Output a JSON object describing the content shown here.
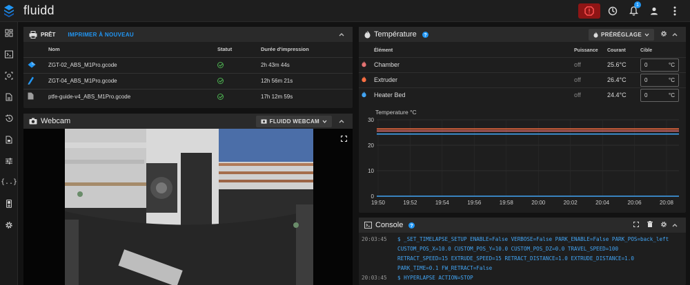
{
  "app": {
    "title": "fluidd",
    "notification_count": "1"
  },
  "colors": {
    "accent": "#2196f3",
    "estop": "#8e1515",
    "ok": "#4caf50",
    "chamber": "#e57373",
    "extruder": "#ff7043",
    "bed": "#42a5f5"
  },
  "sidebar": {
    "items": [
      "dashboard-icon",
      "console-icon",
      "camera-icon",
      "file-icon",
      "history-icon",
      "macro-file-icon",
      "tune-icon",
      "code-braces-icon",
      "device-icon",
      "settings-icon"
    ]
  },
  "status_panel": {
    "title": "PRÊT",
    "reprint_label": "IMPRIMER À NOUVEAU",
    "columns": [
      "Nom",
      "Statut",
      "Durée d'impression"
    ],
    "rows": [
      {
        "name": "ZGT-02_ABS_M1Pro.gcode",
        "time": "2h 43m 44s",
        "icon": "cube-icon"
      },
      {
        "name": "ZGT-04_ABS_M1Pro.gcode",
        "time": "12h 56m 21s",
        "icon": "blade-icon"
      },
      {
        "name": "ptfe-guide-v4_ABS_M1Pro.gcode",
        "time": "17h 12m 59s",
        "icon": "file-icon"
      }
    ]
  },
  "webcam_panel": {
    "title": "Webcam",
    "camera_button": "FLUIDD WEBCAM"
  },
  "temperature_panel": {
    "title": "Température",
    "preset_button": "PRÉRÉGLAGE",
    "columns": [
      "Élément",
      "Puissance",
      "Courant",
      "Cible"
    ],
    "rows": [
      {
        "name": "Chamber",
        "power": "off",
        "current": "25.6°C",
        "target": "0",
        "unit": "°C"
      },
      {
        "name": "Extruder",
        "power": "off",
        "current": "26.4°C",
        "target": "0",
        "unit": "°C"
      },
      {
        "name": "Heater Bed",
        "power": "off",
        "current": "24.4°C",
        "target": "0",
        "unit": "°C"
      }
    ]
  },
  "chart_data": {
    "type": "line",
    "ylabel": "Temperature °C",
    "x": [
      "19:50",
      "19:52",
      "19:54",
      "19:56",
      "19:58",
      "20:00",
      "20:02",
      "20:04",
      "20:06",
      "20:08"
    ],
    "yticks": [
      "30",
      "20",
      "10",
      "0"
    ],
    "ylim": [
      0,
      30
    ],
    "series": [
      {
        "color": "#ff7043",
        "values": [
          26.4,
          26.4,
          26.4,
          26.4,
          26.4,
          26.4,
          26.4,
          26.4,
          26.4,
          26.4
        ]
      },
      {
        "color": "#e57373",
        "values": [
          25.6,
          25.6,
          25.6,
          25.6,
          25.6,
          25.6,
          25.6,
          25.6,
          25.6,
          25.6
        ]
      },
      {
        "color": "#42a5f5",
        "values": [
          24.4,
          24.4,
          24.4,
          24.4,
          24.4,
          24.4,
          24.4,
          24.4,
          24.4,
          24.4
        ]
      },
      {
        "color": "#42a5f5",
        "values": [
          0,
          0,
          0,
          0,
          0,
          0,
          0,
          0,
          0,
          0
        ]
      }
    ]
  },
  "console_panel": {
    "title": "Console",
    "lines": [
      {
        "time": "20:03:45",
        "text": "$ _SET_TIMELAPSE_SETUP ENABLE=False VERBOSE=False PARK_ENABLE=False PARK_POS=back_left"
      },
      {
        "time": "",
        "text": "CUSTOM_POS_X=10.0 CUSTOM_POS_Y=10.0 CUSTOM_POS_DZ=0.0 TRAVEL_SPEED=100"
      },
      {
        "time": "",
        "text": "RETRACT_SPEED=15 EXTRUDE_SPEED=15 RETRACT_DISTANCE=1.0 EXTRUDE_DISTANCE=1.0"
      },
      {
        "time": "",
        "text": "PARK_TIME=0.1 FW_RETRACT=False"
      },
      {
        "time": "20:03:45",
        "text": "$ HYPERLAPSE ACTION=STOP"
      }
    ]
  }
}
